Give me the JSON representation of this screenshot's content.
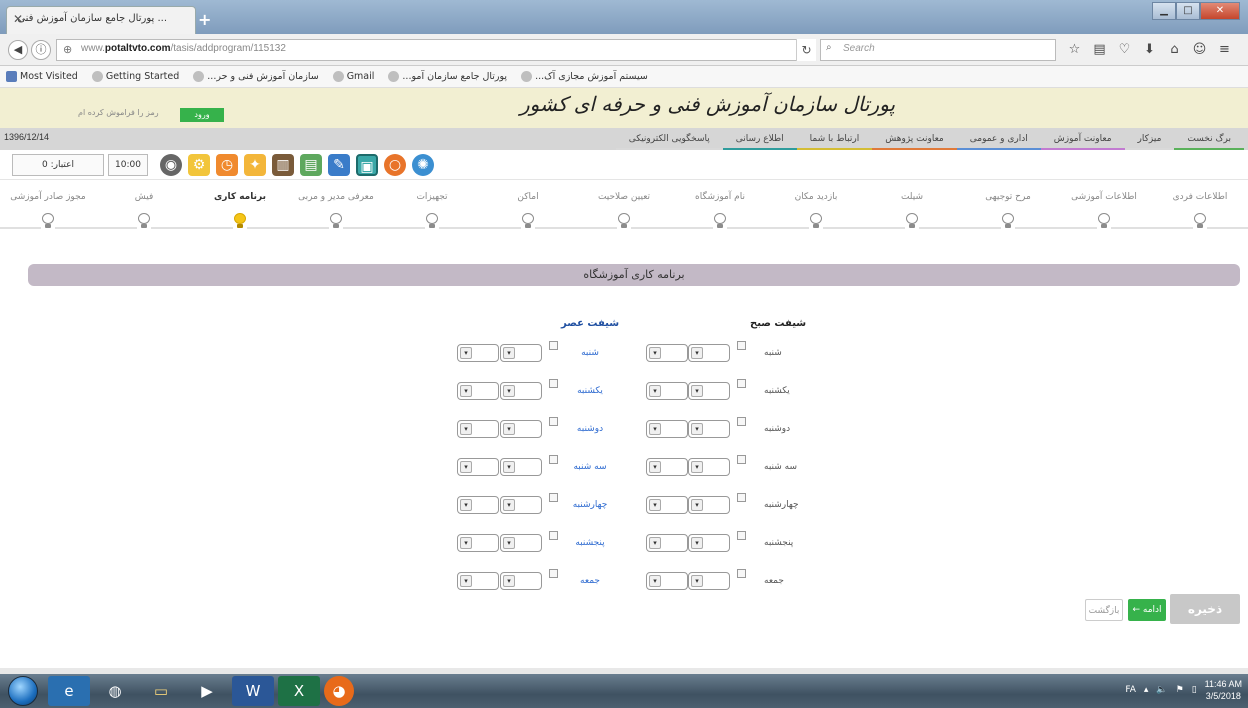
{
  "browser": {
    "tab_title": "... پورتال جامع سازمان آموزش فنی",
    "url_host": "www.potaltvto.com",
    "url_path": "/tasis/addprogram/115132",
    "url_prefix": "www.",
    "url_domain": "potaltvto.com",
    "search_placeholder": "Search",
    "bookmarks": [
      "Most Visited",
      "Getting Started",
      "...سازمان آموزش فنی و حر",
      "Gmail",
      "...پورتال جامع سازمان آمو",
      "...سیستم آموزش مجازی آک"
    ]
  },
  "header": {
    "title": "پورتال سازمان آموزش فنی و حرفه ای کشور",
    "login_button": "ورود",
    "forgot_password": "رمز را فراموش کرده ام"
  },
  "menubar": {
    "date": "1396/12/14",
    "items": [
      "برگ نخست",
      "میزکار",
      "معاونت آموزش",
      "اداری و عمومی",
      "معاونت پژوهش",
      "ارتباط با شما",
      "اطلاع رسانی",
      "پاسخگویی الکترونیکی"
    ],
    "item_colors": [
      "#5ab15a",
      "#d9d9d9",
      "#c27bd1",
      "#5b8fd6",
      "#e07a3a",
      "#d4bd34",
      "#2f9c9c",
      "#d9d9d9"
    ]
  },
  "iconbar": {
    "credit": "اعتبار: 0",
    "time": "10:00",
    "icons": [
      "webcam-icon",
      "gear-icon",
      "clock-icon",
      "lightbulb-folder-icon",
      "books-icon",
      "documents-icon",
      "edit-icon",
      "image-icon",
      "orange-ring-icon",
      "network-icon"
    ]
  },
  "steps": {
    "items": [
      "اطلاعات فردی",
      "اطلاعات آموزشی",
      "مرح توجیهی",
      "شیلت",
      "بازدید مکان",
      "نام آموزشگاه",
      "تعیین صلاحیت",
      "اماکن",
      "تجهیزات",
      "معرفی مدیر و مربی",
      "برنامه کاری",
      "فیش",
      "مجوز صادر آموزشی"
    ],
    "active_index": 10
  },
  "section": {
    "title": "برنامه کاری آموزشگاه"
  },
  "schedule": {
    "morning_title": "شیفت صبح",
    "evening_title": "شیفت عصر",
    "days": [
      "شنبه",
      "یکشنبه",
      "دوشنبه",
      "سه شنبه",
      "چهارشنبه",
      "پنجشنبه",
      "جمعه"
    ]
  },
  "actions": {
    "save": "ذخیره",
    "next": "ادامه ←",
    "back": "بازگشت"
  },
  "taskbar": {
    "lang": "FA",
    "time": "11:46 AM",
    "date": "3/5/2018",
    "apps": [
      "internet-explorer-icon",
      "chrome-icon",
      "file-explorer-icon",
      "media-player-icon",
      "word-icon",
      "excel-icon",
      "firefox-icon"
    ]
  }
}
